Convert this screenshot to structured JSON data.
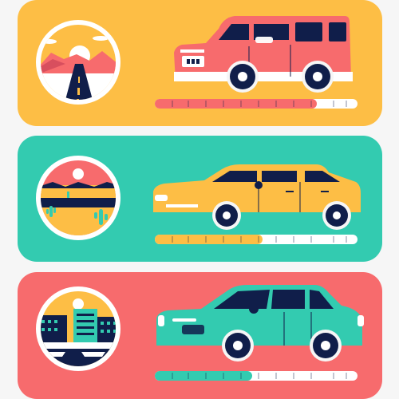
{
  "cards": [
    {
      "id": "suv",
      "scene": "road-landscape",
      "car": "suv",
      "progress": 0.8,
      "colors": {
        "card": "#fdbe45",
        "car": "#f76b6d",
        "bar_fill": "#f76b6d"
      }
    },
    {
      "id": "hatchback",
      "scene": "desert",
      "car": "hatchback",
      "progress": 0.53,
      "colors": {
        "card": "#33cbb0",
        "car": "#fdbe45",
        "bar_fill": "#fdbe45"
      }
    },
    {
      "id": "sedan",
      "scene": "city",
      "car": "sedan",
      "progress": 0.48,
      "colors": {
        "card": "#f76b6d",
        "car": "#33cbb0",
        "bar_fill": "#33cbb0"
      }
    }
  ],
  "colors": {
    "navy": "#101e4a",
    "white": "#ffffff",
    "bar_bg": "#ffffff"
  }
}
